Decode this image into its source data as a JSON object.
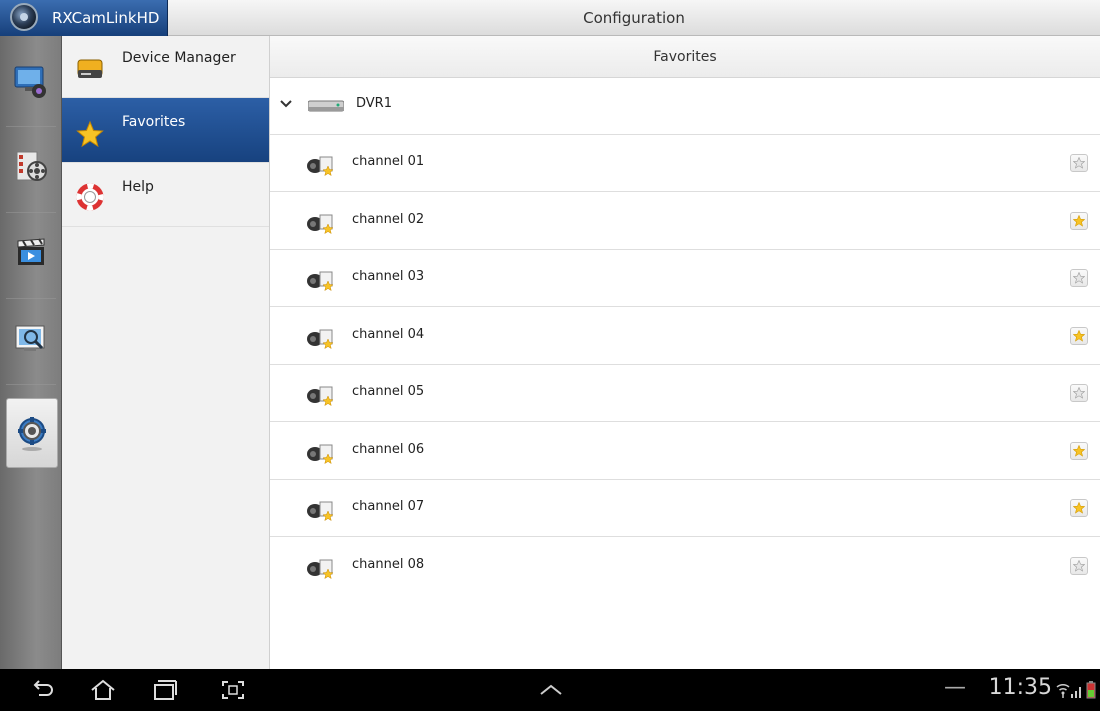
{
  "app": {
    "name": "RXCamLinkHD",
    "screen_title": "Configuration",
    "accent_color": "#1e4f93"
  },
  "rail": {
    "items": [
      {
        "id": "live-view",
        "icon": "monitor-camera-icon"
      },
      {
        "id": "playback",
        "icon": "film-reel-icon"
      },
      {
        "id": "video",
        "icon": "clapperboard-icon"
      },
      {
        "id": "search",
        "icon": "magnifier-screen-icon"
      },
      {
        "id": "configuration",
        "icon": "settings-gear-icon",
        "active": true
      }
    ]
  },
  "menu": {
    "items": [
      {
        "label": "Device Manager",
        "icon": "drive-icon"
      },
      {
        "label": "Favorites",
        "icon": "star-icon",
        "selected": true
      },
      {
        "label": "Help",
        "icon": "lifebuoy-icon"
      }
    ]
  },
  "content": {
    "header": "Favorites",
    "device": {
      "label": "DVR1",
      "expanded": true
    },
    "channels": [
      {
        "label": "channel 01",
        "favorite": false
      },
      {
        "label": "channel 02",
        "favorite": true
      },
      {
        "label": "channel 03",
        "favorite": false
      },
      {
        "label": "channel 04",
        "favorite": true
      },
      {
        "label": "channel 05",
        "favorite": false
      },
      {
        "label": "channel 06",
        "favorite": true
      },
      {
        "label": "channel 07",
        "favorite": true
      },
      {
        "label": "channel 08",
        "favorite": false
      }
    ]
  },
  "statusbar": {
    "time": "11:35",
    "dash": "—"
  }
}
